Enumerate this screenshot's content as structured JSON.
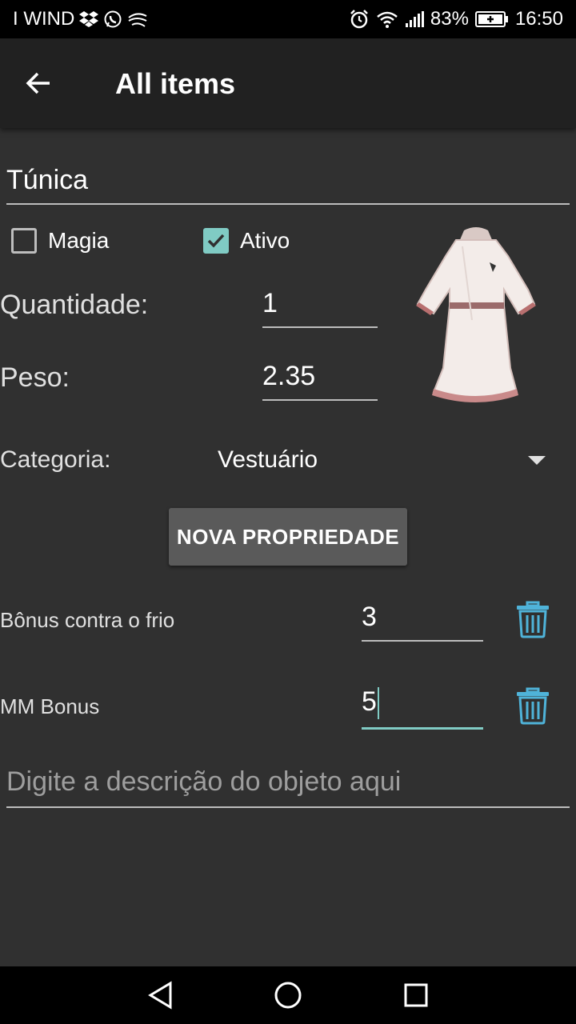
{
  "status_bar": {
    "carrier": "I WIND",
    "battery_percent": "83%",
    "time": "16:50",
    "icons": [
      "dropbox-icon",
      "whatsapp-icon",
      "swiftkey-icon",
      "alarm-icon",
      "wifi-icon",
      "signal-icon",
      "battery-charging-icon"
    ]
  },
  "app_bar": {
    "title": "All items",
    "back_icon": "arrow-back-icon"
  },
  "item": {
    "name": "Túnica",
    "magic_label": "Magia",
    "magic_checked": false,
    "active_label": "Ativo",
    "active_checked": true,
    "quantity_label": "Quantidade:",
    "quantity_value": "1",
    "weight_label": "Peso:",
    "weight_value": "2.35",
    "image": "tunic-image"
  },
  "category": {
    "label": "Categoria:",
    "selected": "Vestuário"
  },
  "new_property_button": "NOVA PROPRIEDADE",
  "properties": [
    {
      "name": "Bônus contra o frio",
      "value": "3"
    },
    {
      "name": "MM Bonus",
      "value": "5"
    }
  ],
  "description": {
    "placeholder": "Digite a descrição do objeto aqui"
  },
  "colors": {
    "accent": "#80cbc4",
    "trash": "#4fb3d9",
    "background": "#303030",
    "app_bar": "#212121"
  }
}
